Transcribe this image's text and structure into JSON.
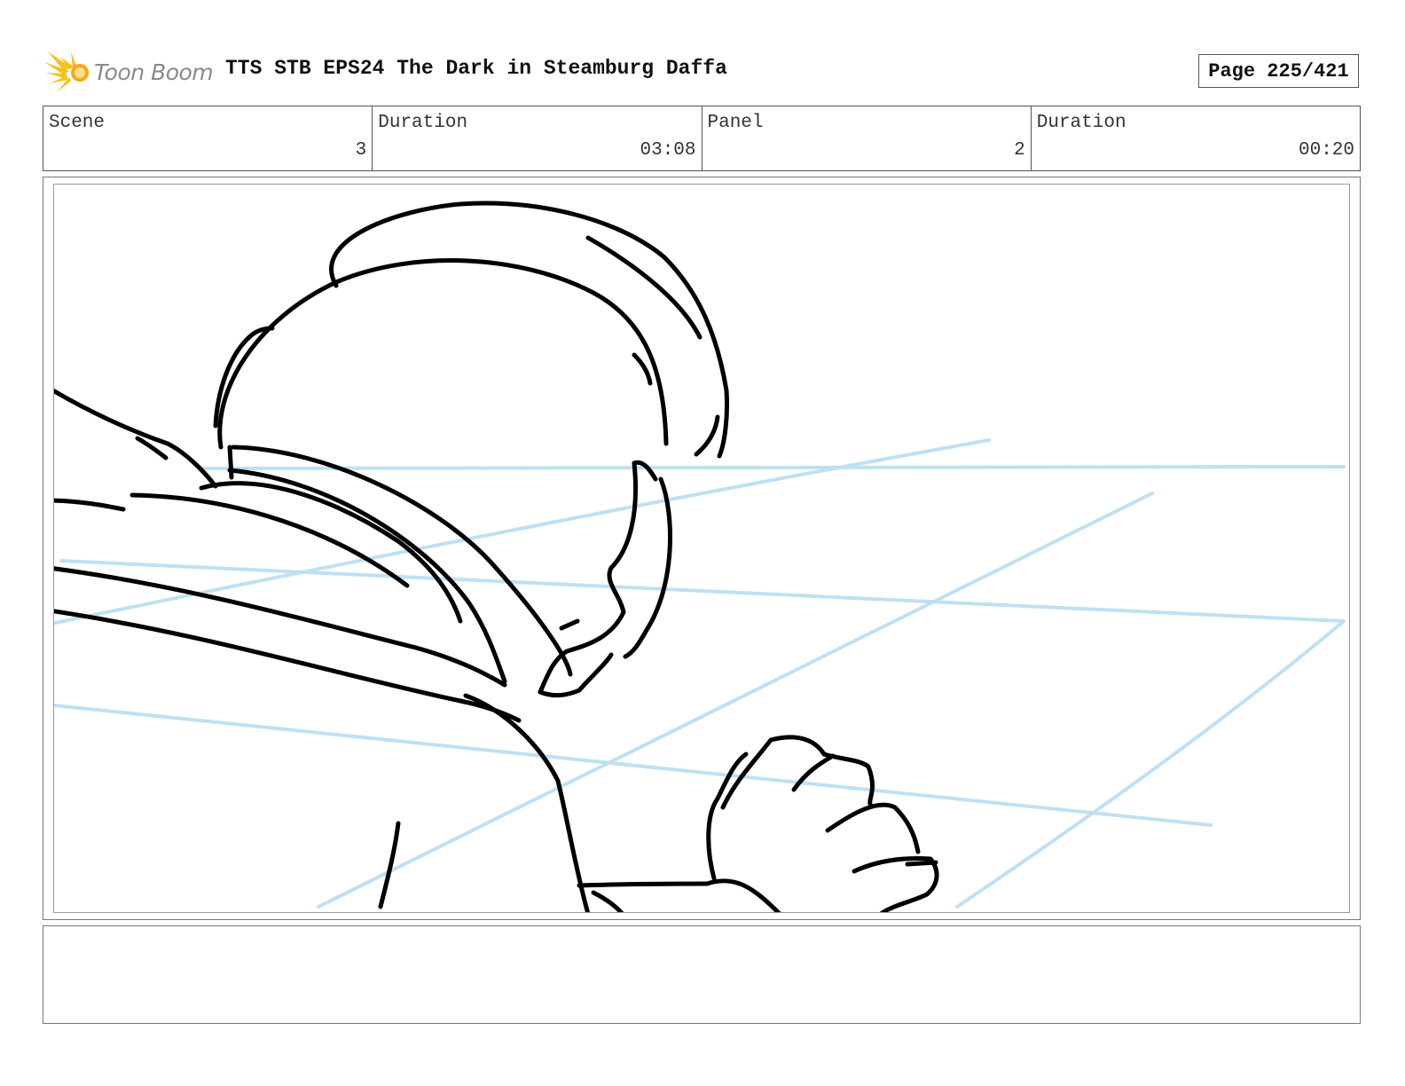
{
  "header": {
    "logo_text": "Toon Boom",
    "title": "TTS STB EPS24 The Dark in Steamburg Daffa",
    "page": "Page 225/421"
  },
  "info": [
    {
      "label": "Scene",
      "value": "3"
    },
    {
      "label": "Duration",
      "value": "03:08"
    },
    {
      "label": "Panel",
      "value": "2"
    },
    {
      "label": "Duration",
      "value": "00:20"
    }
  ],
  "panel": {
    "guide_color": "#bfe0f3",
    "ink_color": "#000000"
  },
  "notes": {
    "text": ""
  }
}
